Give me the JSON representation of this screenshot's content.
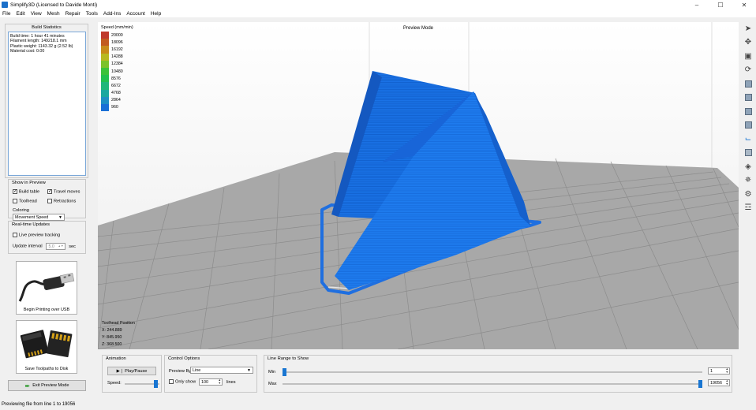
{
  "window": {
    "title": "Simplify3D (Licensed to Davide Monti)",
    "controls": [
      "–",
      "☐",
      "✕"
    ]
  },
  "menu": [
    "File",
    "Edit",
    "View",
    "Mesh",
    "Repair",
    "Tools",
    "Add-Ins",
    "Account",
    "Help"
  ],
  "build_stats": {
    "title": "Build Statistics",
    "lines": [
      "Build time: 1 hour 41 minutes",
      "Filament length: 149218.1 mm",
      "Plastic weight: 1143.32 g (2.52 lb)",
      "Material cost: 0.00"
    ]
  },
  "show_in_preview": {
    "title": "Show in Preview",
    "build_table": {
      "label": "Build table",
      "checked": true
    },
    "travel_moves": {
      "label": "Travel moves",
      "checked": true
    },
    "toolhead": {
      "label": "Toolhead",
      "checked": false
    },
    "retractions": {
      "label": "Retractions",
      "checked": false
    },
    "coloring_label": "Coloring",
    "coloring_value": "Movement Speed"
  },
  "realtime": {
    "title": "Real-time Updates",
    "live_tracking": {
      "label": "Live preview tracking",
      "checked": false
    },
    "interval_label": "Update interval",
    "interval_value": "5.0",
    "interval_unit": "sec"
  },
  "cards": {
    "usb_label": "Begin Printing over USB",
    "sd_label": "Save Toolpaths to Disk"
  },
  "exit_preview": "Exit Preview Mode",
  "viewport": {
    "mode": "Preview Mode",
    "legend_title": "Speed (mm/min)",
    "legend": [
      {
        "value": "20000",
        "color": "#c0392b"
      },
      {
        "value": "18096",
        "color": "#c25a1f"
      },
      {
        "value": "16192",
        "color": "#c88a1a"
      },
      {
        "value": "14288",
        "color": "#b8b820"
      },
      {
        "value": "12384",
        "color": "#7cc22a"
      },
      {
        "value": "10480",
        "color": "#3cc23a"
      },
      {
        "value": "8576",
        "color": "#22c04e"
      },
      {
        "value": "6672",
        "color": "#1fb77a"
      },
      {
        "value": "4768",
        "color": "#1aa8a0"
      },
      {
        "value": "2864",
        "color": "#1f8fc4"
      },
      {
        "value": "960",
        "color": "#1a6fd6"
      }
    ],
    "toolhead_title": "Toolhead Position",
    "toolhead_x": "X: 244.889",
    "toolhead_y": "Y: 845.950",
    "toolhead_z": "Z: 368.500"
  },
  "toolbar_icons": [
    "cursor-icon",
    "move-icon",
    "zoom-fit-icon",
    "rotate-icon",
    "view-iso-icon",
    "view-front-icon",
    "view-side-icon",
    "view-top-icon",
    "axes-icon",
    "wireframe-icon",
    "shell-icon",
    "cross-section-icon",
    "settings-gear-icon",
    "layers-icon"
  ],
  "animation": {
    "title": "Animation",
    "play_label": "▶❘ Play/Pause",
    "speed_label": "Speed:",
    "speed_fraction": 0.95
  },
  "control_options": {
    "title": "Control Options",
    "preview_by_label": "Preview By",
    "preview_by_value": "Line",
    "only_show_label": "Only show",
    "only_show_value": "100",
    "lines_unit": "lines"
  },
  "line_range": {
    "title": "Line Range to Show",
    "min_label": "Min",
    "max_label": "Max",
    "min_value": "1",
    "max_value": "19056",
    "min_fraction": 0.0,
    "max_fraction": 1.0
  },
  "status": "Previewing file from line 1 to 19056"
}
